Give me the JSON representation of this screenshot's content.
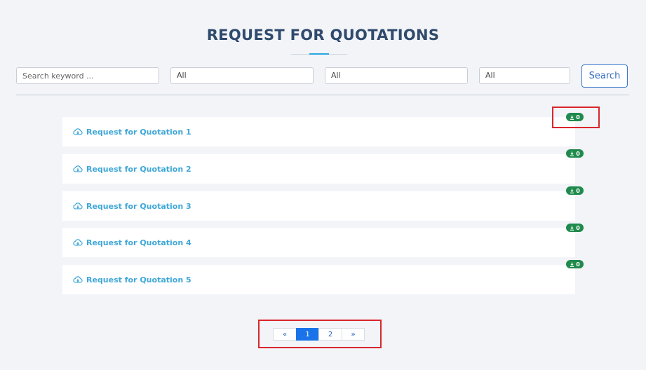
{
  "header": {
    "title": "REQUEST FOR QUOTATIONS"
  },
  "filters": {
    "search_placeholder": "Search keyword ...",
    "select_1_value": "All",
    "select_2_value": "All",
    "select_3_value": "All",
    "search_button_label": "Search"
  },
  "rfq_list": {
    "items": [
      {
        "label": "Request for Quotation 1",
        "downloads": "0"
      },
      {
        "label": "Request for Quotation 2",
        "downloads": "0"
      },
      {
        "label": "Request for Quotation 3",
        "downloads": "0"
      },
      {
        "label": "Request for Quotation 4",
        "downloads": "0"
      },
      {
        "label": "Request for Quotation 5",
        "downloads": "0"
      }
    ]
  },
  "pagination": {
    "prev_label": "«",
    "pages": [
      "1",
      "2"
    ],
    "active_page": "1",
    "next_label": "»"
  },
  "colors": {
    "accent": "#3fa7d8",
    "badge_green": "#1f8a4c",
    "highlight_red": "#d9262c",
    "active_page_blue": "#1a73e8"
  },
  "icons": {
    "row_icon": "cloud-download-icon",
    "badge_icon": "download-icon"
  }
}
